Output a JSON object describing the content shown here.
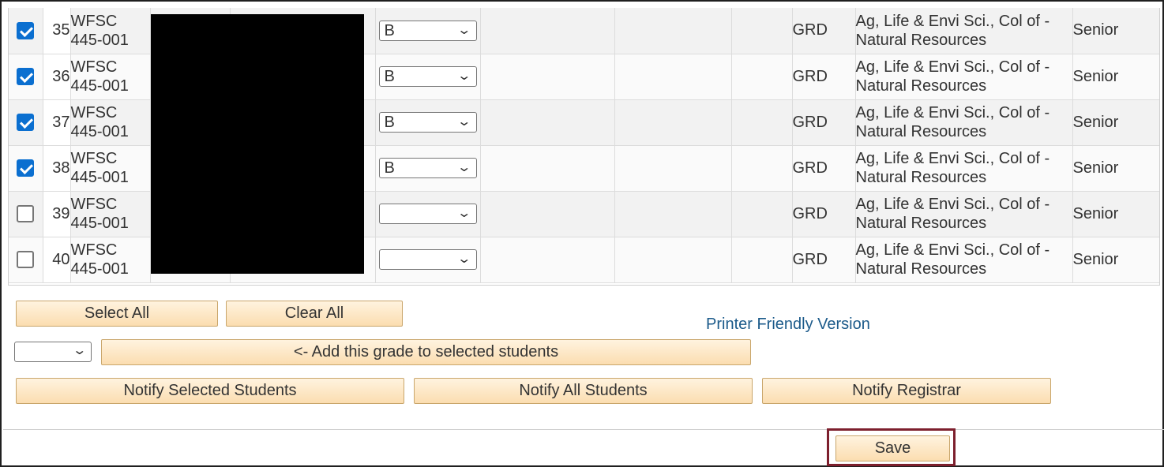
{
  "rows": [
    {
      "checked": true,
      "num": "35",
      "course_line1": "WFSC",
      "course_line2": "445-001",
      "grade": "B",
      "grading_basis": "GRD",
      "program_line1": "Ag, Life & Envi Sci., Col of -",
      "program_line2": "Natural Resources",
      "level": "Senior"
    },
    {
      "checked": true,
      "num": "36",
      "course_line1": "WFSC",
      "course_line2": "445-001",
      "grade": "B",
      "grading_basis": "GRD",
      "program_line1": "Ag, Life & Envi Sci., Col of -",
      "program_line2": "Natural Resources",
      "level": "Senior"
    },
    {
      "checked": true,
      "num": "37",
      "course_line1": "WFSC",
      "course_line2": "445-001",
      "grade": "B",
      "grading_basis": "GRD",
      "program_line1": "Ag, Life & Envi Sci., Col of -",
      "program_line2": "Natural Resources",
      "level": "Senior"
    },
    {
      "checked": true,
      "num": "38",
      "course_line1": "WFSC",
      "course_line2": "445-001",
      "grade": "B",
      "grading_basis": "GRD",
      "program_line1": "Ag, Life & Envi Sci., Col of -",
      "program_line2": "Natural Resources",
      "level": "Senior"
    },
    {
      "checked": false,
      "num": "39",
      "course_line1": "WFSC",
      "course_line2": "445-001",
      "grade": "",
      "grading_basis": "GRD",
      "program_line1": "Ag, Life & Envi Sci., Col of -",
      "program_line2": "Natural Resources",
      "level": "Senior"
    },
    {
      "checked": false,
      "num": "40",
      "course_line1": "WFSC",
      "course_line2": "445-001",
      "grade": "",
      "grading_basis": "GRD",
      "program_line1": "Ag, Life & Envi Sci., Col of -",
      "program_line2": "Natural Resources",
      "level": "Senior"
    }
  ],
  "buttons": {
    "select_all": "Select All",
    "clear_all": "Clear All",
    "add_grade": "<- Add this grade to selected students",
    "notify_selected": "Notify Selected Students",
    "notify_all": "Notify All Students",
    "notify_registrar": "Notify Registrar",
    "save": "Save"
  },
  "links": {
    "printer_friendly": "Printer Friendly Version"
  },
  "bulk_grade_select": {
    "value": ""
  },
  "icons": {
    "dropdown": "chevron-down-icon",
    "checkbox": "checkbox-icon"
  },
  "colors": {
    "checkbox_checked": "#0b6fd0",
    "button_fill": "#fbddb0",
    "link": "#1b5a8a",
    "save_highlight": "#7d1f2d"
  }
}
